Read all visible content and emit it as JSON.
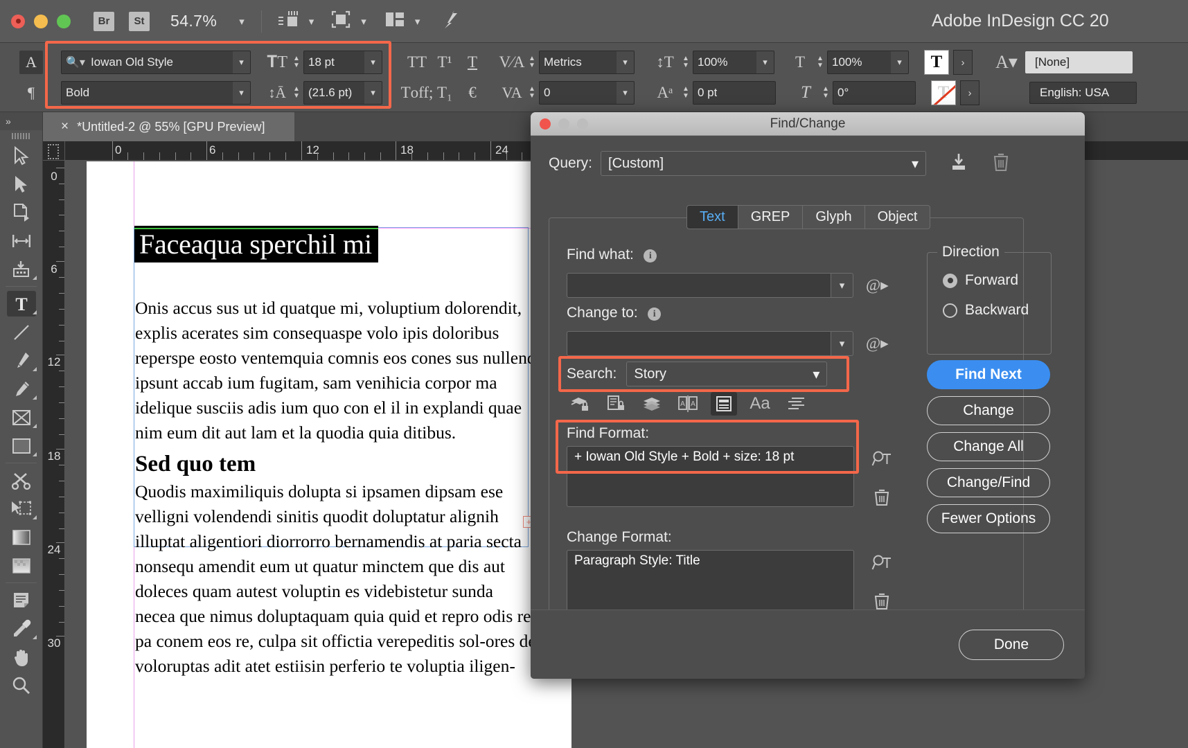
{
  "app": {
    "title": "Adobe InDesign CC 20",
    "zoom": "54.7%",
    "bridge": "Br",
    "stock": "St"
  },
  "control_panel": {
    "font_family": "Iowan Old Style",
    "font_style": "Bold",
    "font_size": "18 pt",
    "leading": "(21.6 pt)",
    "kerning": "Metrics",
    "tracking": "0",
    "vertical_scale": "100%",
    "horizontal_scale": "100%",
    "baseline_shift": "0 pt",
    "skew": "0°",
    "paragraph_style": "[None]",
    "language": "English: USA"
  },
  "document": {
    "tab_title": "*Untitled‑2 @ 55% [GPU Preview]",
    "ruler_h": [
      "0",
      "6",
      "12",
      "18",
      "24"
    ],
    "ruler_v": [
      "0",
      "6",
      "12",
      "18",
      "24",
      "30"
    ],
    "title_heading": "Faceaqua sperchil mi",
    "body_paragraph_1": "Onis accus sus ut id quatque mi, voluptium dolorendit, explis acerates sim consequaspe volo ipis doloribus reperspe eosto ventemquia comnis eos cones sus nullend ipsunt accab ium fugitam, sam venihicia corpor ma idelique susciis adis ium quo con el il in explandi quae nim eum dit aut lam et la quodia quia ditibus.",
    "subheading": "Sed quo tem",
    "body_paragraph_2": "Quodis maximiliquis dolupta si ipsamen dipsam ese velligni volendendi sinitis quodit doluptatur alignih illuptat aligentiori diorrorro bernamendis at paria secta nonsequ amendit eum ut quatur minctem que dis aut doleces quam autest voluptin es videbistetur sunda necea que nimus doluptaquam quia quid et repro odis re pa conem eos re, culpa sit offictia verepeditis sol-ores de voloruptas adit atet estiisin perferio te voluptia iligen-",
    "overset_marker": "+"
  },
  "dialog": {
    "title": "Find/Change",
    "query_label": "Query:",
    "query_value": "[Custom]",
    "tabs": [
      {
        "label": "Text",
        "active": true
      },
      {
        "label": "GREP",
        "active": false
      },
      {
        "label": "Glyph",
        "active": false
      },
      {
        "label": "Object",
        "active": false
      }
    ],
    "find_what_label": "Find what:",
    "find_what_value": "",
    "change_to_label": "Change to:",
    "change_to_value": "",
    "search_label": "Search:",
    "search_value": "Story",
    "find_format_label": "Find Format:",
    "find_format_value": "+ Iowan Old Style + Bold + size: 18 pt",
    "change_format_label": "Change Format:",
    "change_format_value": "Paragraph Style: Title",
    "direction": {
      "title": "Direction",
      "forward": "Forward",
      "backward": "Backward",
      "selected": "Forward"
    },
    "buttons": {
      "find_next": "Find Next",
      "change": "Change",
      "change_all": "Change All",
      "change_find": "Change/Find",
      "fewer_options": "Fewer Options",
      "done": "Done"
    },
    "option_icons": [
      "include-locked-layers-icon",
      "include-locked-stories-icon",
      "include-hidden-layers-icon",
      "include-master-pages-icon",
      "include-footnotes-icon",
      "case-sensitive-icon",
      "whole-word-icon"
    ],
    "option_active_index": 4
  },
  "toolbar_icons": [
    "selection-tool-icon",
    "direct-selection-tool-icon",
    "page-tool-icon",
    "gap-tool-icon",
    "content-collector-tool-icon",
    "type-tool-icon",
    "line-tool-icon",
    "pen-tool-icon",
    "pencil-tool-icon",
    "frame-tool-icon",
    "rectangle-tool-icon",
    "scissors-tool-icon",
    "free-transform-tool-icon",
    "gradient-swatch-tool-icon",
    "gradient-feather-tool-icon",
    "note-tool-icon",
    "eyedropper-tool-icon",
    "hand-tool-icon",
    "zoom-tool-icon"
  ],
  "colors": {
    "accent": "#3b8ef0",
    "highlight": "#f4674a",
    "panel": "#535353",
    "dialog": "#4d4d4d"
  }
}
